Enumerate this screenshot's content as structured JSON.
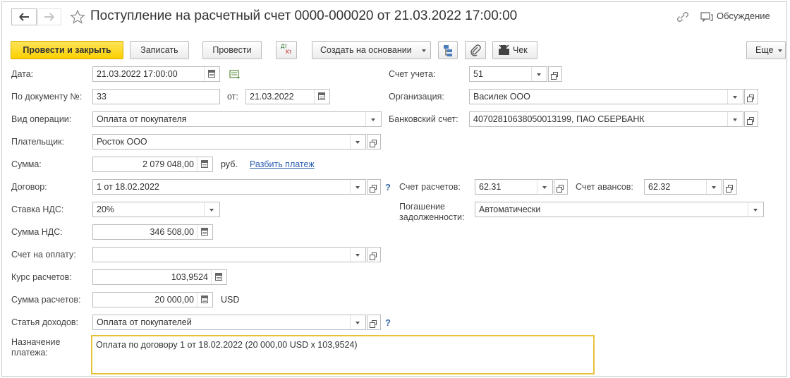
{
  "header": {
    "title": "Поступление на расчетный счет 0000-000020 от 21.03.2022 17:00:00",
    "discussion": "Обсуждение"
  },
  "toolbar": {
    "post_close": "Провести и закрыть",
    "save": "Записать",
    "post": "Провести",
    "dtkt_top": "Дт",
    "dtkt_bottom": "Кт",
    "create_based": "Создать на основании",
    "check": "Чек",
    "more": "Еще"
  },
  "form": {
    "date_label": "Дата:",
    "date": "21.03.2022 17:00:00",
    "doc_label": "По документу №:",
    "doc_number": "33",
    "from_label": "от:",
    "doc_date": "21.03.2022",
    "op_label": "Вид операции:",
    "operation": "Оплата от покупателя",
    "payer_label": "Плательщик:",
    "payer": "Росток ООО",
    "sum_label": "Сумма:",
    "sum": "2 079 048,00",
    "currency_rub": "руб.",
    "split_link": "Разбить платеж",
    "contract_label": "Договор:",
    "contract": "1 от 18.02.2022",
    "vat_rate_label": "Ставка НДС:",
    "vat_rate": "20%",
    "vat_sum_label": "Сумма НДС:",
    "vat_sum": "346 508,00",
    "invoice_label": "Счет на оплату:",
    "invoice": "",
    "rate_label": "Курс расчетов:",
    "rate": "103,9524",
    "settle_sum_label": "Сумма расчетов:",
    "settle_sum": "20 000,00",
    "currency_usd": "USD",
    "income_label": "Статья доходов:",
    "income": "Оплата от покупателей",
    "purpose_label_1": "Назначение",
    "purpose_label_2": "платежа:",
    "purpose": "Оплата по договору 1 от 18.02.2022 (20 000,00 USD x 103,9524)",
    "account_label": "Счет учета:",
    "account": "51",
    "org_label": "Организация:",
    "org": "Василек ООО",
    "bank_label": "Банковский счет:",
    "bank": "40702810638050013199, ПАО СБЕРБАНК",
    "settle_acc_label": "Счет расчетов:",
    "settle_acc": "62.31",
    "advance_label": "Счет авансов:",
    "advance": "62.32",
    "repay_label_1": "Погашение",
    "repay_label_2": "задолженности:",
    "repay": "Автоматически"
  }
}
